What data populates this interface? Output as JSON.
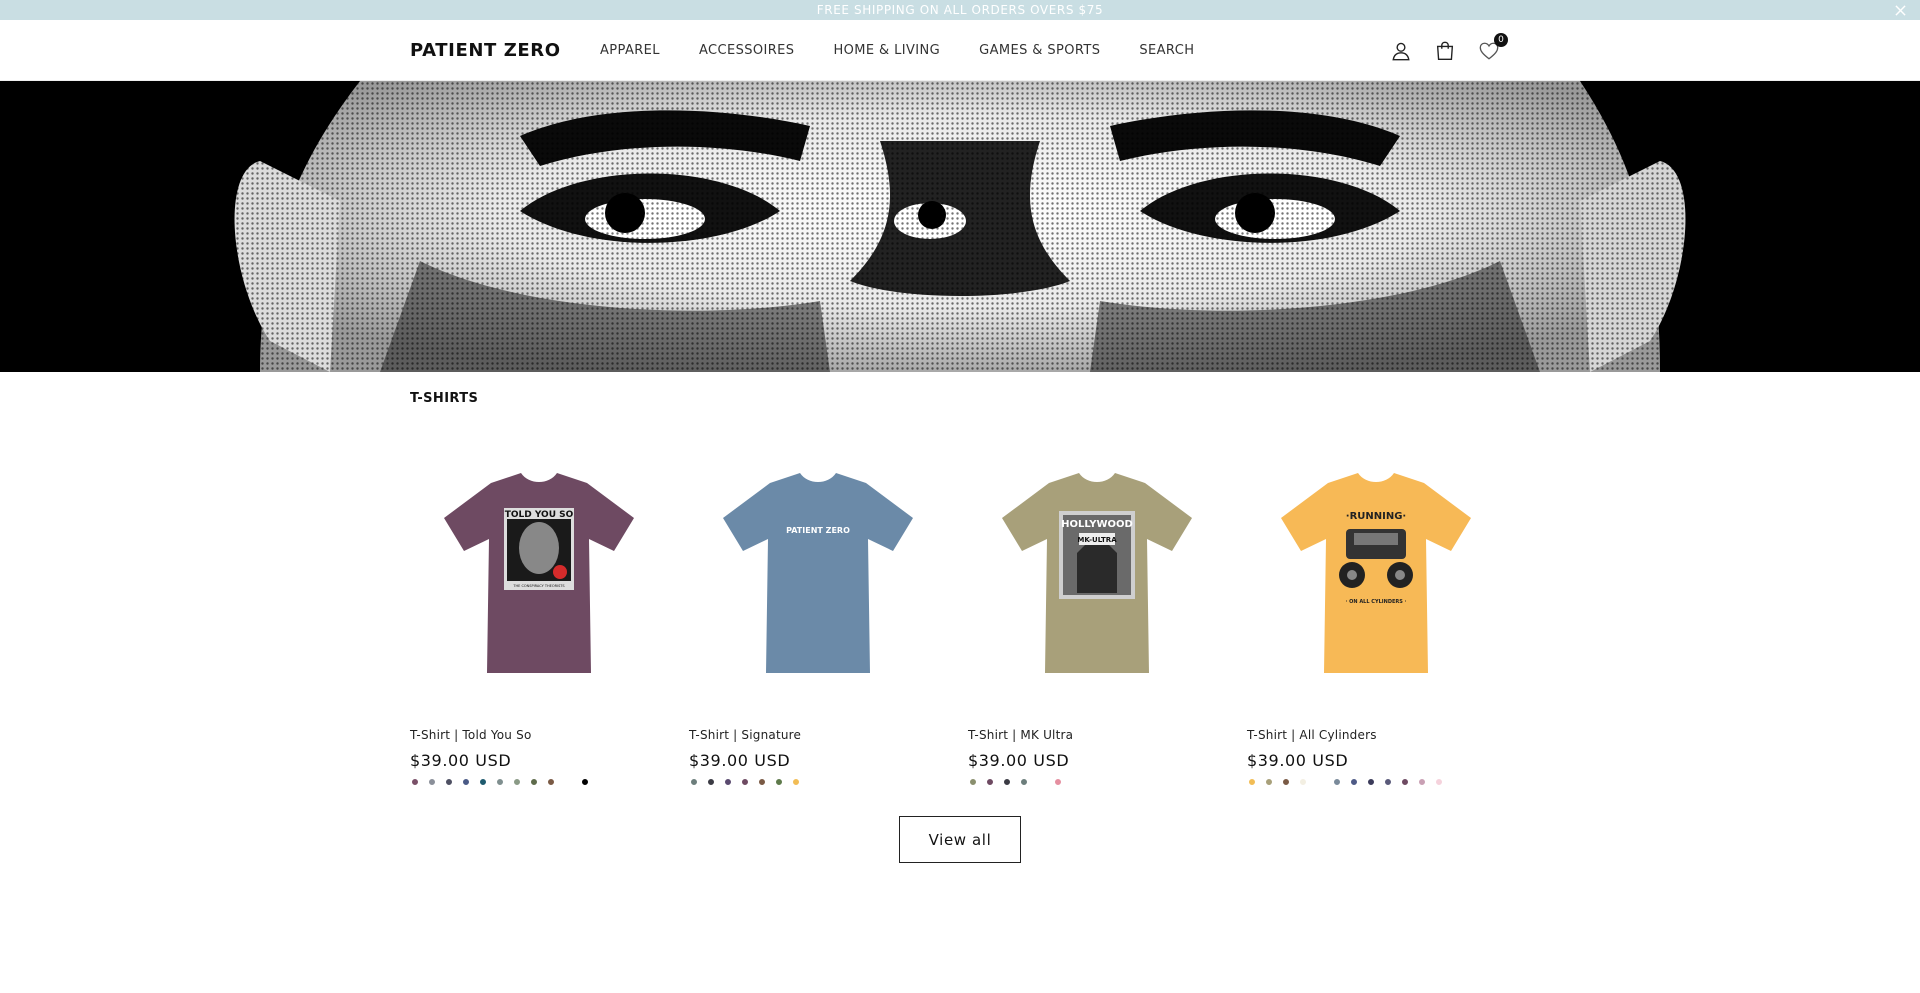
{
  "announcement": {
    "text": "FREE SHIPPING ON ALL ORDERS OVERS $75",
    "close_icon": "close-icon",
    "background": "#c9dee3"
  },
  "header": {
    "logo": "PATIENT ZERO",
    "nav": [
      "APPAREL",
      "ACCESSOIRES",
      "HOME & LIVING",
      "GAMES & SPORTS",
      "SEARCH"
    ],
    "icons": {
      "account": "user-icon",
      "cart": "shopping-bag-icon",
      "wishlist": "heart-icon"
    },
    "wishlist_count": "0"
  },
  "hero": {
    "image": "halftone-eyes-banner"
  },
  "collection": {
    "title": "T-SHIRTS",
    "products": [
      {
        "title": "T-Shirt | Told You So",
        "price": "$39.00 USD",
        "shirt_color": "#6e4a62",
        "print": "told-you-so",
        "swatches": [
          "#7a5068",
          "#8a8f99",
          "#4e5063",
          "#4a5a86",
          "#1e5a6e",
          "#7f8f8f",
          "#8a9a86",
          "#5e6b4b",
          "#7a5a45",
          "",
          "#000000"
        ]
      },
      {
        "title": "T-Shirt | Signature",
        "price": "$39.00 USD",
        "shirt_color": "#6b8aa8",
        "print": "PATIENT ZERO",
        "swatches": [
          "#6c7e7c",
          "#3b3b44",
          "#5a4a6f",
          "#6e4a62",
          "#7a5a45",
          "#5e7a4b",
          "#f2bd55"
        ]
      },
      {
        "title": "T-Shirt | MK Ultra",
        "price": "$39.00 USD",
        "shirt_color": "#a8a07a",
        "print": "HOLLYWOOD MK-ULTRA",
        "swatches": [
          "#8a8f6e",
          "#6e4a62",
          "#3b3b44",
          "#6c7e7c",
          "",
          "#e58fa0"
        ]
      },
      {
        "title": "T-Shirt | All Cylinders",
        "price": "$39.00 USD",
        "shirt_color": "#f7b956",
        "print": "RUNNING ON ALL CYLINDERS",
        "swatches": [
          "#f2bd55",
          "#a8a07a",
          "#7a5a45",
          "#f3efe2",
          "",
          "#7a8a9a",
          "#4e5a86",
          "#3b3b5a",
          "#5a5a7a",
          "#6e4a62",
          "#c9a0b4",
          "#f5d2dc"
        ]
      }
    ],
    "view_all": "View all"
  }
}
